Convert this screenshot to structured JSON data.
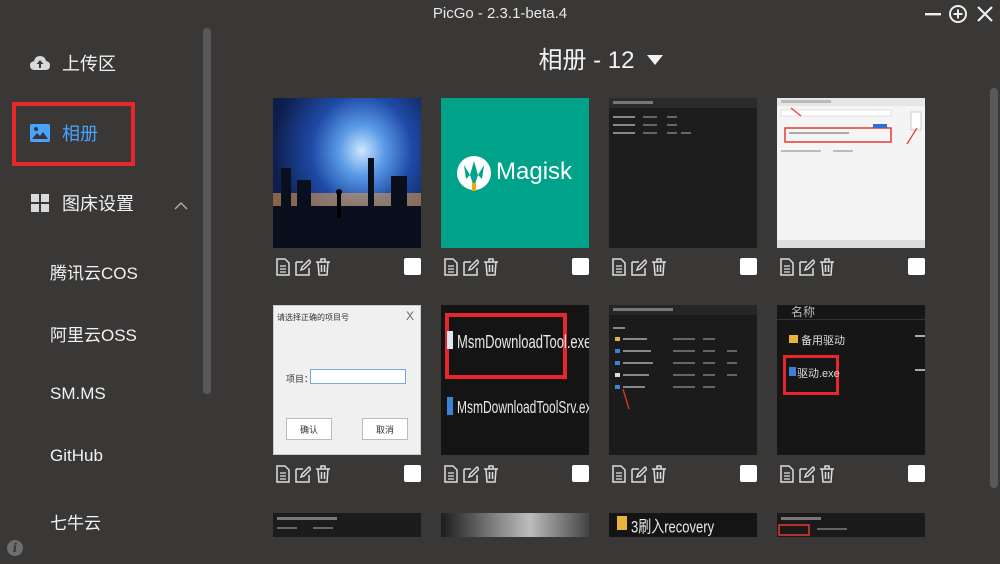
{
  "window": {
    "title": "PicGo - 2.3.1-beta.4"
  },
  "sidebar": {
    "items": [
      {
        "label": "上传区",
        "icon": "cloud-upload-icon"
      },
      {
        "label": "相册",
        "icon": "image-icon",
        "active": true
      },
      {
        "label": "图床设置",
        "icon": "grid-icon",
        "expanded": true
      }
    ],
    "sub_items": [
      "腾讯云COS",
      "阿里云OSS",
      "SM.MS",
      "GitHub",
      "七牛云"
    ]
  },
  "album": {
    "title": "相册 - 12"
  },
  "thumbs": {
    "magisk": "Magisk",
    "dialog_title": "请选择正确的项目号",
    "dialog_label": "项目：",
    "dialog_ok": "确认",
    "dialog_cancel": "取消",
    "msm1": "MsmDownloadTool.exe",
    "msm2": "MsmDownloadToolSrv.exe",
    "driver_header": "名称",
    "driver_folder": "备用驱动",
    "driver_file": "驱动.exe",
    "recovery": "3刷入recovery"
  },
  "colors": {
    "accent": "#4aa3ff",
    "highlight": "#e8262e",
    "magisk_bg": "#00a38a",
    "background": "#3a3837"
  }
}
